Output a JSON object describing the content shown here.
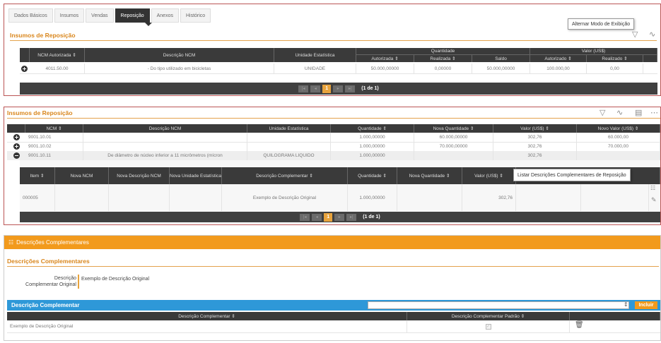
{
  "tabs": [
    "Dados Básicos",
    "Insumos",
    "Vendas",
    "Reposição",
    "Anexos",
    "Histórico"
  ],
  "active_tab": "Reposição",
  "tooltip1": "Alternar Modo de Exibição",
  "panel1": {
    "title": "Insumos de Reposição",
    "headers": {
      "ncm": "NCM Autorizada ⇕",
      "desc": "Descrição NCM",
      "unit": "Unidade Estatística",
      "qty_group": "Quantidade",
      "qty_auth": "Autorizada ⇕",
      "qty_real": "Realizada ⇕",
      "qty_saldo": "Saldo",
      "val_group": "Valor (US$)",
      "val_auth": "Autorizado ⇕",
      "val_real": "Realizado ⇕"
    },
    "row": {
      "ncm": "4011.50.00",
      "desc": "- Do tipo utilizado em bicicletas",
      "unit": "UNIDADE",
      "qty_auth": "50.000,00000",
      "qty_real": "0,00000",
      "qty_saldo": "50.000,00000",
      "val_auth": "100.000,00",
      "val_real": "0,00"
    },
    "pager": {
      "page": "1",
      "info": "(1 de 1)"
    }
  },
  "panel2": {
    "title": "Insumos de Reposição",
    "headers": {
      "ncm": "NCM ⇕",
      "desc": "Descrição NCM",
      "unit": "Unidade Estatística",
      "qty": "Quantidade ⇕",
      "new_qty": "Nova Quantidade ⇕",
      "val": "Valor (US$) ⇕",
      "new_val": "Novo Valor (US$) ⇕"
    },
    "rows": [
      {
        "ncm": "9001.10.01",
        "desc": "",
        "unit": "",
        "qty": "1.000,00000",
        "new_qty": "60.000,00000",
        "val": "302,76",
        "new_val": "60.000,00"
      },
      {
        "ncm": "9001.10.02",
        "desc": "",
        "unit": "",
        "qty": "1.000,00000",
        "new_qty": "70.000,00000",
        "val": "302,76",
        "new_val": "70.000,00"
      },
      {
        "ncm": "9001.10.11",
        "desc": "De diâmetro de núcleo inferior a 11 micrômetros (mícron",
        "unit": "QUILOGRAMA LIQUIDO",
        "qty": "1.000,00000",
        "new_qty": "",
        "val": "302,76",
        "new_val": ""
      }
    ],
    "sub_headers": {
      "item": "Item ⇕",
      "new_ncm": "Nova NCM",
      "new_desc": "Nova Descrição NCM",
      "new_unit": "Nova Unidade Estatística",
      "comp": "Descrição Complementar ⇕",
      "qty": "Quantidade ⇕",
      "new_qty": "Nova Quantidade ⇕",
      "val": "Valor (US$) ⇕"
    },
    "sub_row": {
      "item": "000005",
      "comp": "Exemplo de Descrição Original",
      "qty": "1.000,00000",
      "val": "302,76"
    },
    "tooltip": "Listar Descrições Complementares de Reposição",
    "pager": {
      "page": "1",
      "info": "(1 de 1)"
    }
  },
  "panel3": {
    "bar_title": "Descrições Complementares",
    "section_title": "Descrições Complementares",
    "orig_label_1": "Descrição",
    "orig_label_2": "Complementar Original",
    "orig_value": "Exemplo de Descrição Original",
    "blue_label": "Descrição Complementar",
    "include_label": "Incluir",
    "col1": "Descrição Complementar ⇕",
    "col2": "Descrição Complementar Padrão ⇕",
    "row_value": "Exemplo de Descrição Original"
  },
  "colors": {
    "accent": "#e8a33c",
    "header_dark": "#3a3a3a",
    "blue": "#2e98d8",
    "orange": "#f29a1c"
  }
}
